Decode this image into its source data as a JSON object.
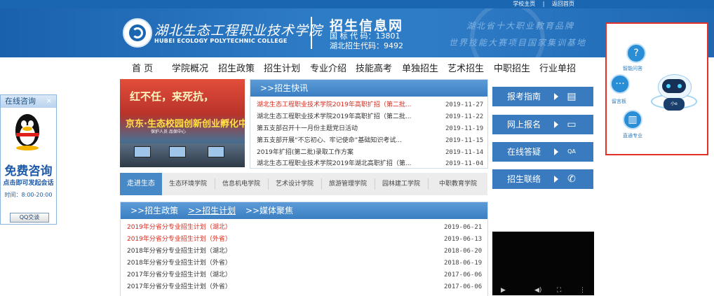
{
  "top_links": {
    "school_home": "学校主页",
    "separator": "|",
    "back_home": "返回首页"
  },
  "header": {
    "college_cn": "湖北生态工程职业技术学院",
    "college_en": "HUBEI ECOLOGY POLYTECHNIC COLLEGE",
    "site_title": "招生信息网",
    "national_code": "国 标 代 码：13801",
    "hubei_code": "湖北招生代码：9492",
    "slogan_1": "湖北省十大职业教育品牌",
    "slogan_2": "世界技能大赛项目国家集训基地"
  },
  "nav": [
    "首 页",
    "学院概况",
    "招生政策",
    "招生计划",
    "专业介绍",
    "技能高考",
    "单独招生",
    "艺术招生",
    "中职招生",
    "行业单招"
  ],
  "banner": {
    "line1": "红不任，来死抗，",
    "line2": "京东·生态校园创新创业孵化中心",
    "line3": "保护人员  品保中心"
  },
  "news": {
    "title": ">>招生快讯",
    "items": [
      {
        "text": "湖北生态工程职业技术学院2019年高职扩招（第二批...",
        "date": "2019-11-27",
        "highlight": true
      },
      {
        "text": "湖北生态工程职业技术学院2019年高职扩招（第二批...",
        "date": "2019-11-22",
        "highlight": false
      },
      {
        "text": "第五支部召开十一月份主题党日活动",
        "date": "2019-11-19",
        "highlight": false
      },
      {
        "text": "第五支部开展“不忘初心、牢记使命”基础知识考试...",
        "date": "2019-11-15",
        "highlight": false
      },
      {
        "text": "2019年扩招(第二批)录取工作方案",
        "date": "2019-11-14",
        "highlight": false
      },
      {
        "text": "湖北生态工程职业技术学院2019年湖北高职扩招（第...",
        "date": "2019-11-04",
        "highlight": false
      }
    ]
  },
  "tabs": [
    "走进生态",
    "生态环境学院",
    "信息机电学院",
    "艺术设计学院",
    "旅游管理学院",
    "园林建工学院",
    "中职教育学院"
  ],
  "policy": {
    "title_a": ">>招生政策",
    "title_b": ">>招生计划",
    "title_c": ">>媒体聚焦",
    "items": [
      {
        "text": "2019年分省分专业招生计划（湖北）",
        "date": "2019-06-21",
        "highlight": true
      },
      {
        "text": "2019年分省分专业招生计划（外省）",
        "date": "2019-06-13",
        "highlight": true
      },
      {
        "text": "2018年分省分专业招生计划（湖北）",
        "date": "2018-06-20",
        "highlight": false
      },
      {
        "text": "2018年分省分专业招生计划（外省）",
        "date": "2018-06-19",
        "highlight": false
      },
      {
        "text": "2017年分省分专业招生计划（湖北）",
        "date": "2017-06-06",
        "highlight": false
      },
      {
        "text": "2017年分省分专业招生计划（外省）",
        "date": "2017-06-06",
        "highlight": false
      }
    ]
  },
  "services": [
    {
      "label": "报考指南",
      "icon": "document-icon",
      "glyph": "▤"
    },
    {
      "label": "网上报名",
      "icon": "computer-icon",
      "glyph": "▭"
    },
    {
      "label": "在线答疑",
      "icon": "qa-chat-icon",
      "glyph": "QA"
    },
    {
      "label": "招生联络",
      "icon": "phone-icon",
      "glyph": "✆"
    }
  ],
  "assistant": {
    "qa_label": "智能问答",
    "msg_label": "留言板",
    "major_label": "直通专业",
    "robot_badge": "小e"
  },
  "qq": {
    "header": "在线咨询",
    "close": "×",
    "free": "免费咨询",
    "sub": "点击即可发起会话",
    "time": "时间：8:00-20:00",
    "button": "QQ交谈"
  },
  "colors": {
    "brand_blue": "#1b66b1",
    "tab_blue": "#4788c6",
    "highlight_red": "#d52b1e",
    "assistant_border": "#e3312a"
  }
}
